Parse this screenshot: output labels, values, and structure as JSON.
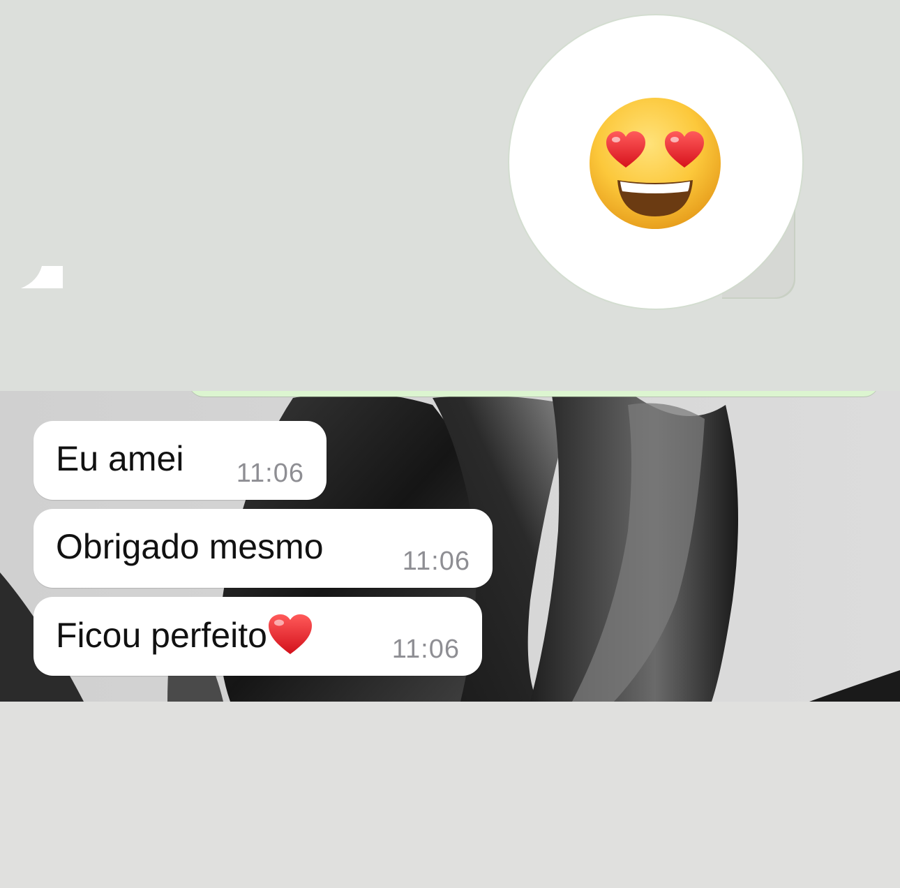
{
  "outgoing": {
    "emoji": "smiling-face-with-heart-eyes"
  },
  "messages": [
    {
      "text": "Eu amei",
      "time": "11:06"
    },
    {
      "text": "Obrigado mesmo",
      "time": "11:06"
    },
    {
      "text": "Ficou perfeito",
      "emoji": "red-heart",
      "time": "11:06"
    }
  ],
  "colors": {
    "page_background": "#dcdfdb",
    "bubble_incoming": "#ffffff",
    "bubble_outgoing_edge": "#dcf5d0",
    "timestamp": "#8e8e93",
    "emoji_yellow": "#fdc93a",
    "heart_red": "#e8202a"
  }
}
